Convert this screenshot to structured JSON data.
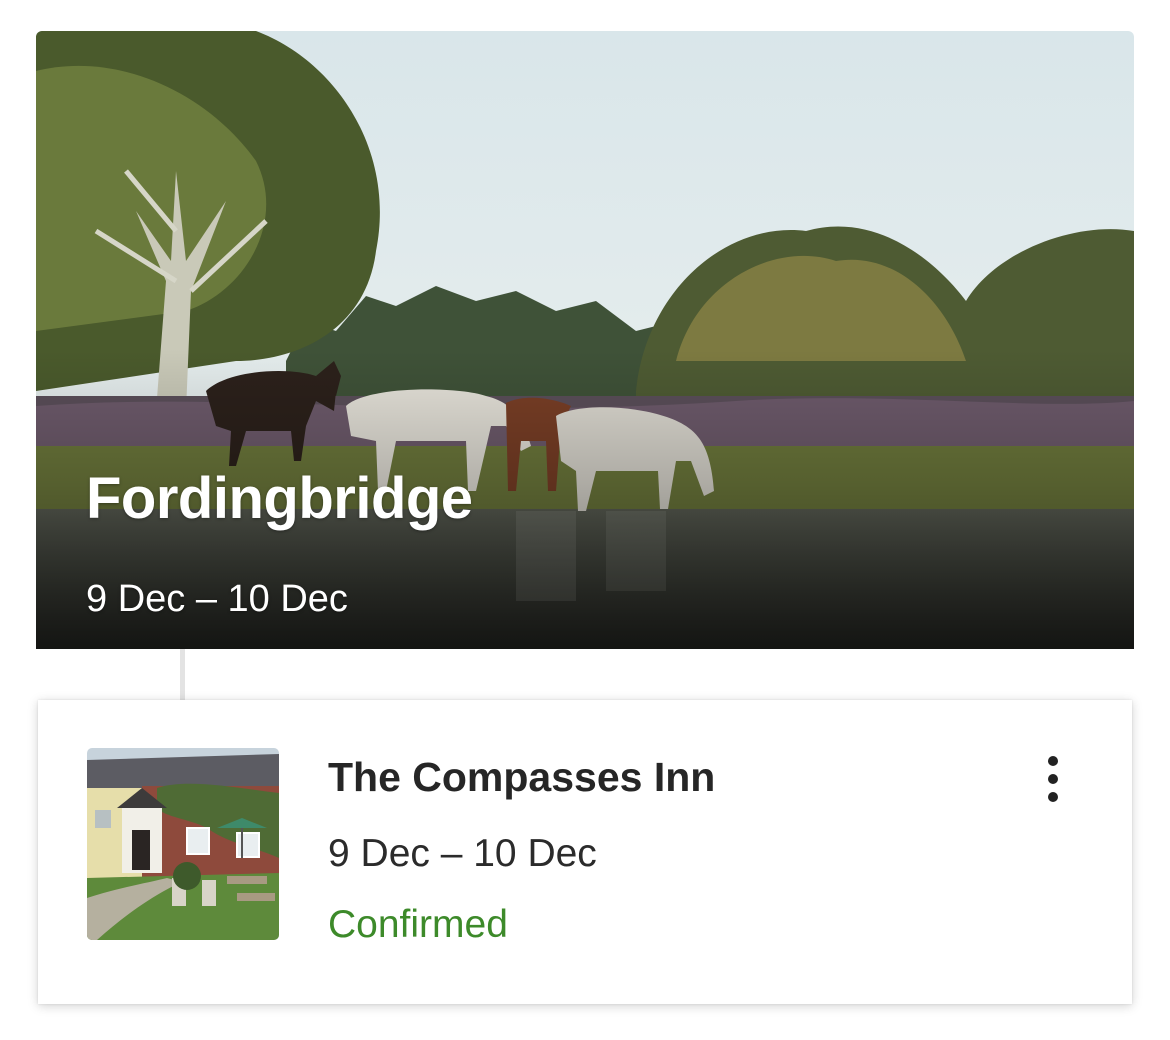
{
  "destination": {
    "name": "Fordingbridge",
    "dates": "9 Dec – 10 Dec",
    "image": "new-forest-ponies-at-pond"
  },
  "booking": {
    "name": "The Compasses Inn",
    "dates": "9 Dec – 10 Dec",
    "status": "Confirmed",
    "status_color": "#3d8a2a",
    "image": "inn-exterior-photo",
    "menu_icon": "more-vertical-icon"
  }
}
